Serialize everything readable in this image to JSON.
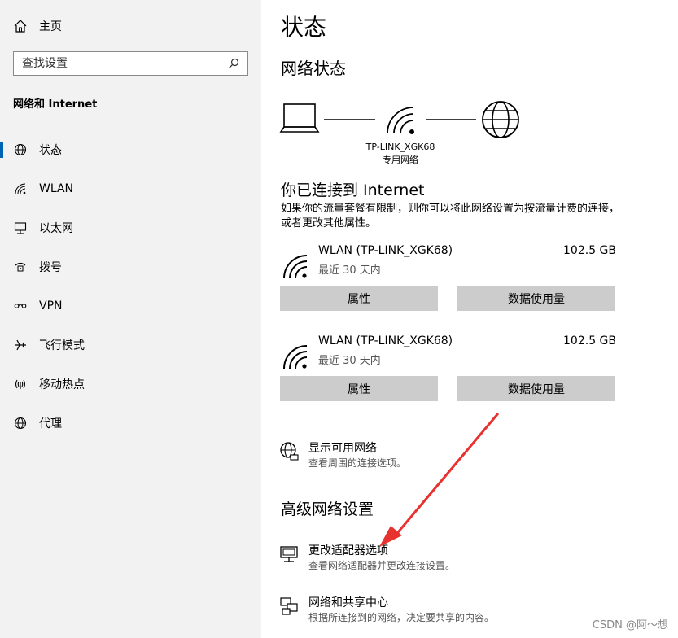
{
  "sidebar": {
    "home_label": "主页",
    "search_placeholder": "查找设置",
    "section_title": "网络和 Internet",
    "items": [
      {
        "label": "状态",
        "icon": "globe-status-icon"
      },
      {
        "label": "WLAN",
        "icon": "wifi-icon"
      },
      {
        "label": "以太网",
        "icon": "ethernet-icon"
      },
      {
        "label": "拨号",
        "icon": "dialup-icon"
      },
      {
        "label": "VPN",
        "icon": "vpn-icon"
      },
      {
        "label": "飞行模式",
        "icon": "airplane-icon"
      },
      {
        "label": "移动热点",
        "icon": "hotspot-icon"
      },
      {
        "label": "代理",
        "icon": "globe-icon"
      }
    ]
  },
  "main": {
    "title": "状态",
    "network_status_heading": "网络状态",
    "network_name": "TP-LINK_XGK68",
    "network_type": "专用网络",
    "connected_heading": "你已连接到 Internet",
    "connected_desc": "如果你的流量套餐有限制，则你可以将此网络设置为按流量计费的连接，或者更改其他属性。",
    "connections": [
      {
        "name": "WLAN (TP-LINK_XGK68)",
        "sub": "最近 30 天内",
        "size": "102.5 GB",
        "btn_properties": "属性",
        "btn_usage": "数据使用量"
      },
      {
        "name": "WLAN (TP-LINK_XGK68)",
        "sub": "最近 30 天内",
        "size": "102.5 GB",
        "btn_properties": "属性",
        "btn_usage": "数据使用量"
      }
    ],
    "show_networks": {
      "title": "显示可用网络",
      "desc": "查看周围的连接选项。"
    },
    "advanced_heading": "高级网络设置",
    "adapter_options": {
      "title": "更改适配器选项",
      "desc": "查看网络适配器并更改连接设置。"
    },
    "sharing_center": {
      "title": "网络和共享中心",
      "desc": "根据所连接到的网络，决定要共享的内容。"
    }
  },
  "watermark": "CSDN @阿～想",
  "colors": {
    "accent": "#0063b1",
    "arrow": "#e8322f",
    "button": "#cccccc",
    "sidebar_bg": "#f2f2f2"
  }
}
